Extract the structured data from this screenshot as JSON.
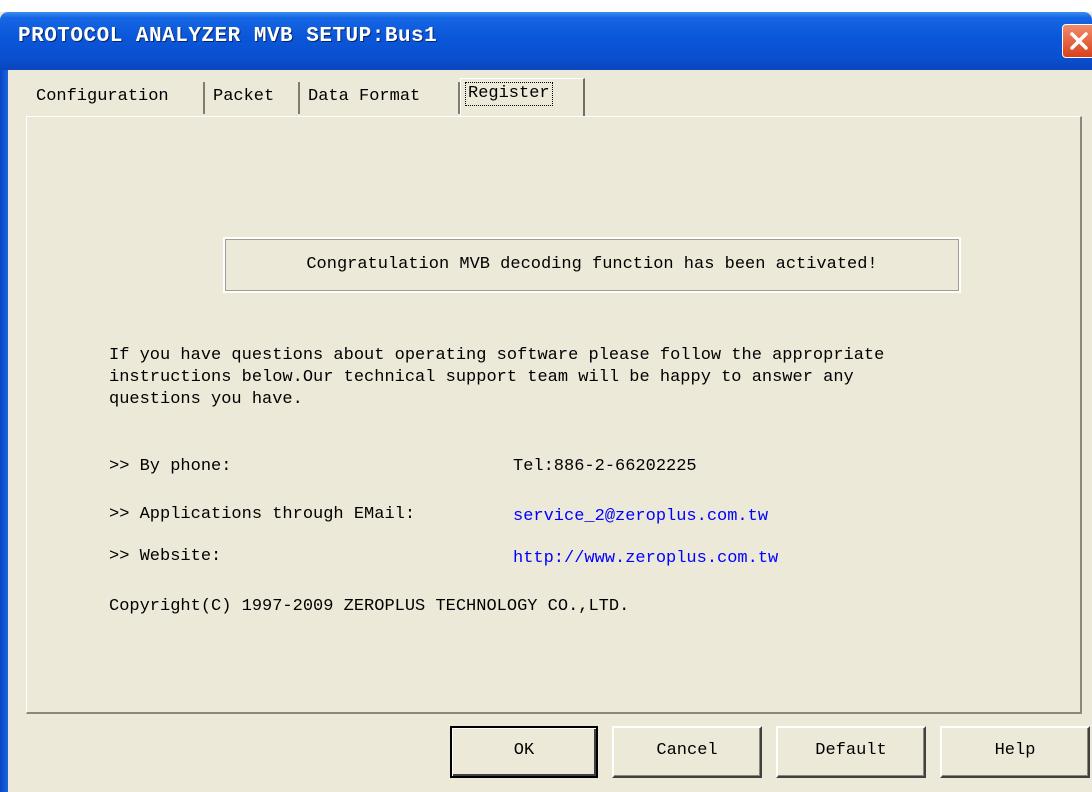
{
  "window": {
    "title": "PROTOCOL ANALYZER MVB SETUP:Bus1",
    "close_icon": "close-x-icon"
  },
  "tabs": [
    {
      "label": "Configuration",
      "active": false
    },
    {
      "label": "Packet",
      "active": false
    },
    {
      "label": "Data Format",
      "active": false
    },
    {
      "label": "Register",
      "active": true
    }
  ],
  "register": {
    "activation_message": "Congratulation MVB decoding function has been activated!",
    "info_lines": [
      "If you have questions about operating software please follow the appropriate",
      "instructions below.Our technical support team will be happy to answer any",
      "questions you have."
    ],
    "contacts": [
      {
        "label": ">> By phone:",
        "value": "Tel:886-2-66202225",
        "is_link": false
      },
      {
        "label": ">> Applications through EMail:",
        "value": "service_2@zeroplus.com.tw",
        "is_link": true
      },
      {
        "label": ">> Website:",
        "value": "http://www.zeroplus.com.tw",
        "is_link": true
      }
    ],
    "copyright": "Copyright(C) 1997-2009 ZEROPLUS TECHNOLOGY CO.,LTD."
  },
  "buttons": {
    "ok": "OK",
    "cancel": "Cancel",
    "default": "Default",
    "help": "Help"
  },
  "colors": {
    "titlebar": "#0a56d8",
    "dialog_bg": "#ece9d8",
    "link": "#0000ff",
    "close_button": "#d9401b"
  }
}
